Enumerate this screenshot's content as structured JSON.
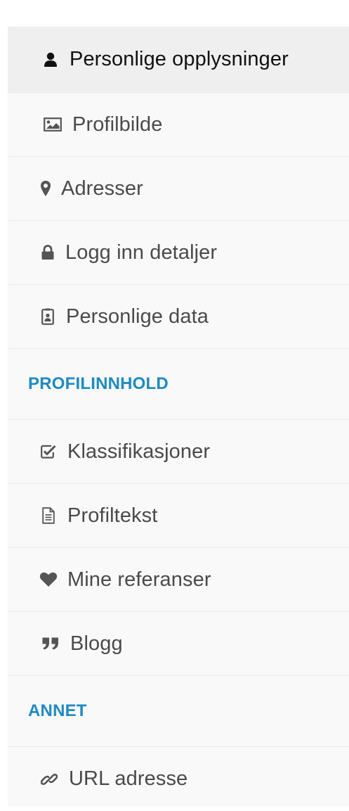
{
  "menu": {
    "personal": [
      {
        "label": "Personlige opplysninger",
        "icon": "user-icon",
        "active": true
      },
      {
        "label": "Profilbilde",
        "icon": "image-icon",
        "active": false
      },
      {
        "label": "Adresser",
        "icon": "map-marker-icon",
        "active": false
      },
      {
        "label": "Logg inn detaljer",
        "icon": "lock-icon",
        "active": false
      },
      {
        "label": "Personlige data",
        "icon": "id-badge-icon",
        "active": false
      }
    ],
    "profile_section": {
      "heading": "PROFILINNHOLD",
      "items": [
        {
          "label": "Klassifikasjoner",
          "icon": "check-square-icon"
        },
        {
          "label": "Profiltekst",
          "icon": "document-icon"
        },
        {
          "label": "Mine referanser",
          "icon": "heart-icon"
        },
        {
          "label": "Blogg",
          "icon": "quote-icon"
        }
      ]
    },
    "other_section": {
      "heading": "ANNET",
      "items": [
        {
          "label": "URL adresse",
          "icon": "link-icon"
        }
      ]
    }
  },
  "colors": {
    "section_heading": "#1f8ac0",
    "active_background": "#efefef",
    "menu_background": "#f9f9f9",
    "icon": "#555555"
  }
}
